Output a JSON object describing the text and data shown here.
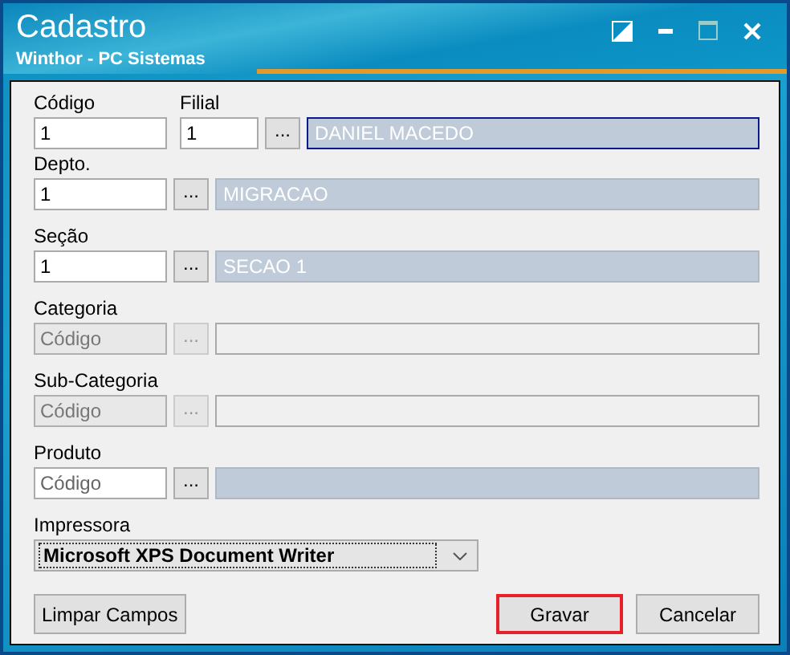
{
  "window": {
    "title": "Cadastro",
    "subtitle": "Winthor - PC Sistemas"
  },
  "codigo": {
    "label": "Código",
    "value": "1"
  },
  "lookups": [
    {
      "label": "Filial",
      "value": "1",
      "disabled": false,
      "focused": true,
      "description": "DANIEL MACEDO"
    },
    {
      "label": "Depto.",
      "value": "1",
      "disabled": false,
      "focused": false,
      "description": "MIGRACAO"
    },
    {
      "label": "Seção",
      "value": "1",
      "disabled": false,
      "focused": false,
      "description": "SECAO 1"
    },
    {
      "label": "Categoria",
      "placeholder": "Código",
      "disabled": true,
      "focused": false
    },
    {
      "label": "Sub-Categoria",
      "placeholder": "Código",
      "disabled": true,
      "focused": false
    },
    {
      "label": "Produto",
      "placeholder": "Código",
      "disabled": false,
      "focused": false
    }
  ],
  "lookup_button": "...",
  "impressora": {
    "label": "Impressora",
    "value": "Microsoft XPS Document Writer"
  },
  "buttons": [
    {
      "label": "Limpar Campos",
      "highlighted": false
    },
    {
      "label": "Gravar",
      "highlighted": true
    },
    {
      "label": "Cancelar",
      "highlighted": false
    }
  ]
}
